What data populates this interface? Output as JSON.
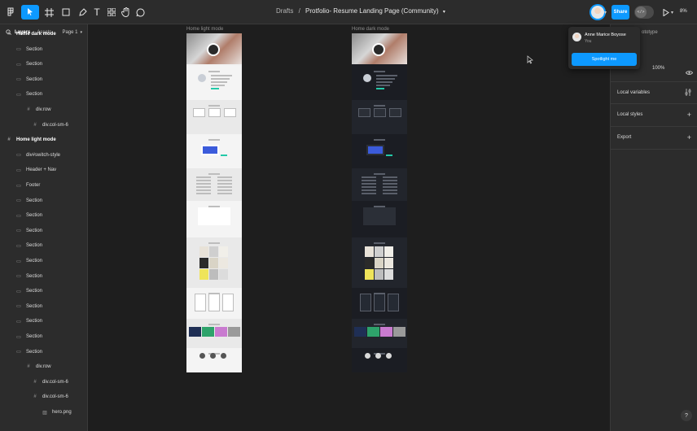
{
  "toolbar": {
    "breadcrumb_folder": "Drafts",
    "separator": "/",
    "file_name": "Protfolio- Resume Landing Page (Community)",
    "share_label": "Share",
    "zoom_label": "8%",
    "dev_mode_label": "</>",
    "icons": [
      "figma-menu-icon",
      "move-tool-icon",
      "frame-tool-icon",
      "shape-tool-icon",
      "pen-tool-icon",
      "text-tool-icon",
      "resources-icon",
      "hand-tool-icon",
      "comment-tool-icon",
      "present-icon"
    ],
    "colors": {
      "accent": "#0d99ff",
      "bar": "#2c2c2c"
    }
  },
  "left_panel": {
    "tab_layers": "Layers",
    "tab_assets": "Assets",
    "page_selector": "Page 1",
    "layers": [
      {
        "label": "Home dark mode",
        "type": "frame"
      },
      {
        "label": "Section",
        "type": "section"
      },
      {
        "label": "Section",
        "type": "section"
      },
      {
        "label": "Section",
        "type": "section"
      },
      {
        "label": "Section",
        "type": "section"
      },
      {
        "label": "div.row",
        "type": "frame"
      },
      {
        "label": "div.col-sm-6",
        "type": "frame"
      },
      {
        "label": "Home light mode",
        "type": "frame"
      },
      {
        "label": "div#switch-style",
        "type": "section"
      },
      {
        "label": "Header + Nav",
        "type": "section"
      },
      {
        "label": "Footer",
        "type": "section"
      },
      {
        "label": "Section",
        "type": "section"
      },
      {
        "label": "Section",
        "type": "section"
      },
      {
        "label": "Section",
        "type": "section"
      },
      {
        "label": "Section",
        "type": "section"
      },
      {
        "label": "Section",
        "type": "section"
      },
      {
        "label": "Section",
        "type": "section"
      },
      {
        "label": "Section",
        "type": "section"
      },
      {
        "label": "Section",
        "type": "section"
      },
      {
        "label": "Section",
        "type": "section"
      },
      {
        "label": "Section",
        "type": "section"
      },
      {
        "label": "Section",
        "type": "section"
      },
      {
        "label": "div.row",
        "type": "frame"
      },
      {
        "label": "div.col-sm-6",
        "type": "frame"
      },
      {
        "label": "div.col-sm-6",
        "type": "frame"
      },
      {
        "label": "hero.png",
        "type": "image"
      }
    ]
  },
  "canvas": {
    "frames": [
      {
        "label": "Home light mode",
        "theme": "light"
      },
      {
        "label": "Home dark mode",
        "theme": "dark"
      }
    ]
  },
  "popup": {
    "user_name": "Anne Marice Boyose",
    "user_sub": "You",
    "spotlight_label": "Spotlight me"
  },
  "right_panel": {
    "tab_partial": "ototype",
    "zoom_value": "100%",
    "sections": [
      {
        "label": "Local variables",
        "action": "adjust-icon"
      },
      {
        "label": "Local styles",
        "action": "plus-icon"
      },
      {
        "label": "Export",
        "action": "plus-icon"
      }
    ],
    "help_label": "?"
  }
}
